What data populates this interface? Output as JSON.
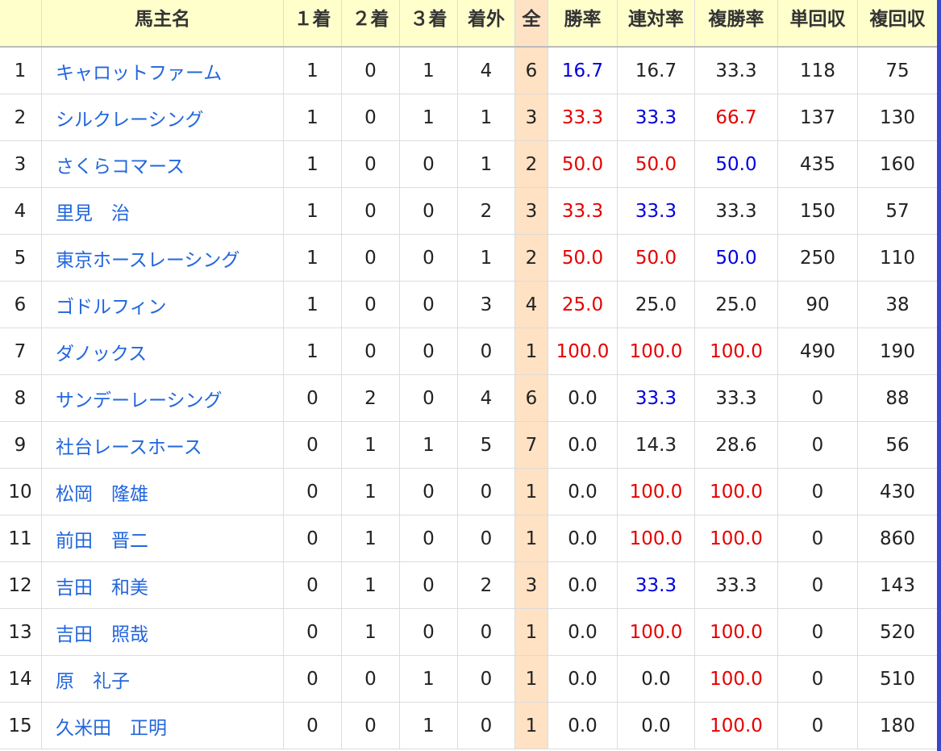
{
  "headers": {
    "rank": "",
    "owner": "馬主名",
    "first": "１着",
    "second": "２着",
    "third": "３着",
    "out": "着外",
    "total": "全",
    "win_rate": "勝率",
    "quinella_rate": "連対率",
    "place_rate": "複勝率",
    "win_return": "単回収",
    "place_return": "複回収"
  },
  "rows": [
    {
      "rank": "1",
      "owner": "キャロットファーム",
      "first": "1",
      "second": "0",
      "third": "1",
      "out": "4",
      "total": "6",
      "win_rate": "16.7",
      "win_rate_color": "blue",
      "quinella_rate": "16.7",
      "quinella_rate_color": "black",
      "place_rate": "33.3",
      "place_rate_color": "black",
      "win_return": "118",
      "place_return": "75"
    },
    {
      "rank": "2",
      "owner": "シルクレーシング",
      "first": "1",
      "second": "0",
      "third": "1",
      "out": "1",
      "total": "3",
      "win_rate": "33.3",
      "win_rate_color": "red",
      "quinella_rate": "33.3",
      "quinella_rate_color": "blue",
      "place_rate": "66.7",
      "place_rate_color": "red",
      "win_return": "137",
      "place_return": "130"
    },
    {
      "rank": "3",
      "owner": "さくらコマース",
      "first": "1",
      "second": "0",
      "third": "0",
      "out": "1",
      "total": "2",
      "win_rate": "50.0",
      "win_rate_color": "red",
      "quinella_rate": "50.0",
      "quinella_rate_color": "red",
      "place_rate": "50.0",
      "place_rate_color": "blue",
      "win_return": "435",
      "place_return": "160"
    },
    {
      "rank": "4",
      "owner": "里見　治",
      "first": "1",
      "second": "0",
      "third": "0",
      "out": "2",
      "total": "3",
      "win_rate": "33.3",
      "win_rate_color": "red",
      "quinella_rate": "33.3",
      "quinella_rate_color": "blue",
      "place_rate": "33.3",
      "place_rate_color": "black",
      "win_return": "150",
      "place_return": "57"
    },
    {
      "rank": "5",
      "owner": "東京ホースレーシング",
      "first": "1",
      "second": "0",
      "third": "0",
      "out": "1",
      "total": "2",
      "win_rate": "50.0",
      "win_rate_color": "red",
      "quinella_rate": "50.0",
      "quinella_rate_color": "red",
      "place_rate": "50.0",
      "place_rate_color": "blue",
      "win_return": "250",
      "place_return": "110"
    },
    {
      "rank": "6",
      "owner": "ゴドルフィン",
      "first": "1",
      "second": "0",
      "third": "0",
      "out": "3",
      "total": "4",
      "win_rate": "25.0",
      "win_rate_color": "red",
      "quinella_rate": "25.0",
      "quinella_rate_color": "black",
      "place_rate": "25.0",
      "place_rate_color": "black",
      "win_return": "90",
      "place_return": "38"
    },
    {
      "rank": "7",
      "owner": "ダノックス",
      "first": "1",
      "second": "0",
      "third": "0",
      "out": "0",
      "total": "1",
      "win_rate": "100.0",
      "win_rate_color": "red",
      "quinella_rate": "100.0",
      "quinella_rate_color": "red",
      "place_rate": "100.0",
      "place_rate_color": "red",
      "win_return": "490",
      "place_return": "190"
    },
    {
      "rank": "8",
      "owner": "サンデーレーシング",
      "first": "0",
      "second": "2",
      "third": "0",
      "out": "4",
      "total": "6",
      "win_rate": "0.0",
      "win_rate_color": "black",
      "quinella_rate": "33.3",
      "quinella_rate_color": "blue",
      "place_rate": "33.3",
      "place_rate_color": "black",
      "win_return": "0",
      "place_return": "88"
    },
    {
      "rank": "9",
      "owner": "社台レースホース",
      "first": "0",
      "second": "1",
      "third": "1",
      "out": "5",
      "total": "7",
      "win_rate": "0.0",
      "win_rate_color": "black",
      "quinella_rate": "14.3",
      "quinella_rate_color": "black",
      "place_rate": "28.6",
      "place_rate_color": "black",
      "win_return": "0",
      "place_return": "56"
    },
    {
      "rank": "10",
      "owner": "松岡　隆雄",
      "first": "0",
      "second": "1",
      "third": "0",
      "out": "0",
      "total": "1",
      "win_rate": "0.0",
      "win_rate_color": "black",
      "quinella_rate": "100.0",
      "quinella_rate_color": "red",
      "place_rate": "100.0",
      "place_rate_color": "red",
      "win_return": "0",
      "place_return": "430"
    },
    {
      "rank": "11",
      "owner": "前田　晋二",
      "first": "0",
      "second": "1",
      "third": "0",
      "out": "0",
      "total": "1",
      "win_rate": "0.0",
      "win_rate_color": "black",
      "quinella_rate": "100.0",
      "quinella_rate_color": "red",
      "place_rate": "100.0",
      "place_rate_color": "red",
      "win_return": "0",
      "place_return": "860"
    },
    {
      "rank": "12",
      "owner": "吉田　和美",
      "first": "0",
      "second": "1",
      "third": "0",
      "out": "2",
      "total": "3",
      "win_rate": "0.0",
      "win_rate_color": "black",
      "quinella_rate": "33.3",
      "quinella_rate_color": "blue",
      "place_rate": "33.3",
      "place_rate_color": "black",
      "win_return": "0",
      "place_return": "143"
    },
    {
      "rank": "13",
      "owner": "吉田　照哉",
      "first": "0",
      "second": "1",
      "third": "0",
      "out": "0",
      "total": "1",
      "win_rate": "0.0",
      "win_rate_color": "black",
      "quinella_rate": "100.0",
      "quinella_rate_color": "red",
      "place_rate": "100.0",
      "place_rate_color": "red",
      "win_return": "0",
      "place_return": "520"
    },
    {
      "rank": "14",
      "owner": "原　礼子",
      "first": "0",
      "second": "0",
      "third": "1",
      "out": "0",
      "total": "1",
      "win_rate": "0.0",
      "win_rate_color": "black",
      "quinella_rate": "0.0",
      "quinella_rate_color": "black",
      "place_rate": "100.0",
      "place_rate_color": "red",
      "win_return": "0",
      "place_return": "510"
    },
    {
      "rank": "15",
      "owner": "久米田　正明",
      "first": "0",
      "second": "0",
      "third": "1",
      "out": "0",
      "total": "1",
      "win_rate": "0.0",
      "win_rate_color": "black",
      "quinella_rate": "0.0",
      "quinella_rate_color": "black",
      "place_rate": "100.0",
      "place_rate_color": "red",
      "win_return": "0",
      "place_return": "180"
    }
  ],
  "colors": {
    "header_bg": "#ffffcc",
    "total_column_bg": "#ffe2c4",
    "link": "#2266dd",
    "highlight_red": "#e60000",
    "highlight_blue": "#0000e0",
    "edge_accent": "#3a46c8"
  }
}
